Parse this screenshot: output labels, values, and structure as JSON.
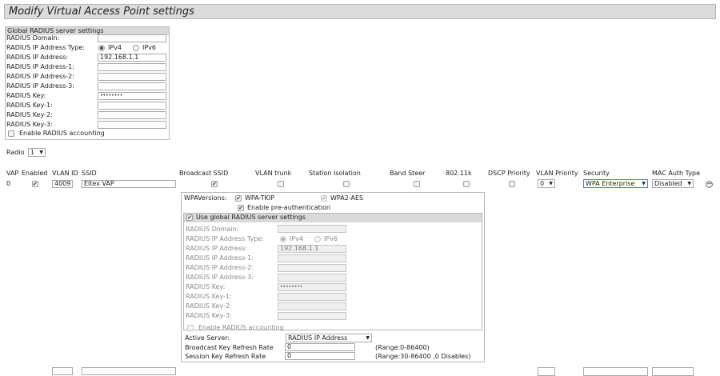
{
  "page": {
    "title": "Modify Virtual Access Point settings"
  },
  "global_radius": {
    "title": "Global RADIUS server settings",
    "domain_label": "RADIUS Domain:",
    "ip_type_label": "RADIUS IP Address Type:",
    "ipv4_label": "IPv4",
    "ipv6_label": "IPv6",
    "ip_label": "RADIUS IP Address:",
    "ip_value": "192.168.1.1",
    "ip1_label": "RADIUS IP Address-1:",
    "ip2_label": "RADIUS IP Address-2:",
    "ip3_label": "RADIUS IP Address-3:",
    "key_label": "RADIUS Key:",
    "key_value": "••••••••",
    "key1_label": "RADIUS Key-1:",
    "key2_label": "RADIUS Key-2:",
    "key3_label": "RADIUS Key-3:",
    "accounting_label": "Enable RADIUS accounting"
  },
  "radio": {
    "label": "Radio",
    "value": "1"
  },
  "vap_table": {
    "headers": [
      "VAP",
      "Enabled",
      "VLAN ID",
      "SSID",
      "Broadcast SSID",
      "VLAN trunk",
      "Station Isolation",
      "Band Steer",
      "802.11k",
      "DSCP Priority",
      "VLAN Priority",
      "Security",
      "MAC Auth Type"
    ],
    "row": {
      "vap": "0",
      "vlan_id": "4009",
      "ssid": "Eltex VAP",
      "vlan_priority": "0",
      "security": "WPA Enterprise",
      "mac_auth": "Disabled"
    }
  },
  "security_panel": {
    "wpa_versions_label": "WPAVersions:",
    "wpa_tkip_label": "WPA-TKIP",
    "wpa2_aes_label": "WPA2-AES",
    "preauth_label": "Enable pre-authentication",
    "use_global_label": "Use global RADIUS server settings",
    "domain_label": "RADIUS Domain:",
    "ip_type_label": "RADIUS IP Address Type:",
    "ipv4_label": "IPv4",
    "ipv6_label": "IPv6",
    "ip_label": "RADIUS IP Address:",
    "ip_value": "192.168.1.1",
    "ip1_label": "RADIUS IP Address-1:",
    "ip2_label": "RADIUS IP Address-2:",
    "ip3_label": "RADIUS IP Address-3:",
    "key_label": "RADIUS Key:",
    "key_value": "••••••••",
    "key1_label": "RADIUS Key-1:",
    "key2_label": "RADIUS Key-2:",
    "key3_label": "RADIUS Key-3:",
    "accounting_label": "Enable RADIUS accounting",
    "active_server_label": "Active Server:",
    "active_server_value": "RADIUS IP Address",
    "broadcast_key_label": "Broadcast Key Refresh Rate",
    "broadcast_key_value": "0",
    "broadcast_key_range": "(Range:0-86400)",
    "session_key_label": "Session Key Refresh Rate",
    "session_key_value": "0",
    "session_key_range": "(Range:30-86400 ,0 Disables)"
  }
}
